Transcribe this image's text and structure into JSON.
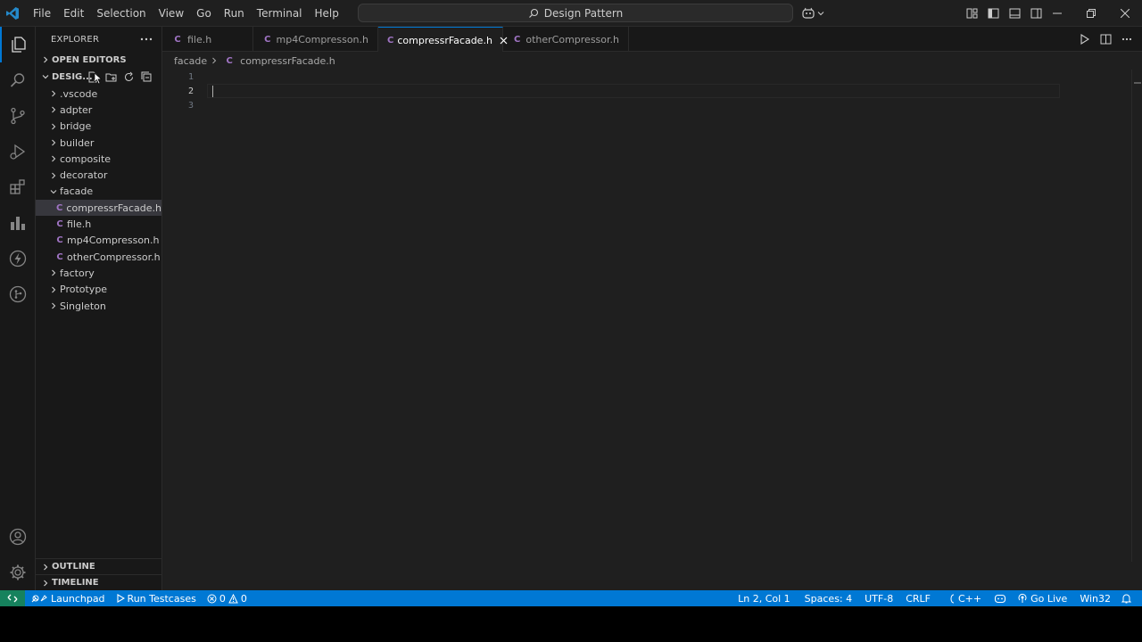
{
  "titlebar": {
    "menus": [
      "File",
      "Edit",
      "Selection",
      "View",
      "Go",
      "Run",
      "Terminal",
      "Help"
    ],
    "search_text": "Design Pattern"
  },
  "explorer": {
    "title": "EXPLORER",
    "open_editors": "OPEN EDITORS",
    "folder_name": "DESIG...",
    "tree": [
      {
        "label": ".vscode",
        "type": "folder",
        "expanded": false
      },
      {
        "label": "adpter",
        "type": "folder",
        "expanded": false
      },
      {
        "label": "bridge",
        "type": "folder",
        "expanded": false
      },
      {
        "label": "builder",
        "type": "folder",
        "expanded": false
      },
      {
        "label": "composite",
        "type": "folder",
        "expanded": false
      },
      {
        "label": "decorator",
        "type": "folder",
        "expanded": false
      },
      {
        "label": "facade",
        "type": "folder",
        "expanded": true
      },
      {
        "label": "compressrFacade.h",
        "type": "file",
        "selected": true
      },
      {
        "label": "file.h",
        "type": "file"
      },
      {
        "label": "mp4Compresson.h",
        "type": "file"
      },
      {
        "label": "otherCompressor.h",
        "type": "file"
      },
      {
        "label": "factory",
        "type": "folder",
        "expanded": false
      },
      {
        "label": "Prototype",
        "type": "folder",
        "expanded": false
      },
      {
        "label": "Singleton",
        "type": "folder",
        "expanded": false
      }
    ],
    "outline": "OUTLINE",
    "timeline": "TIMELINE"
  },
  "tabs": [
    {
      "label": "file.h",
      "icon": "C",
      "active": false
    },
    {
      "label": "mp4Compresson.h",
      "icon": "C",
      "active": false
    },
    {
      "label": "compressrFacade.h",
      "icon": "C",
      "active": true
    },
    {
      "label": "otherCompressor.h",
      "icon": "C",
      "active": false
    }
  ],
  "file_icon_letter": "C",
  "breadcrumb": {
    "folder": "facade",
    "file": "compressrFacade.h"
  },
  "editor": {
    "line_numbers": [
      "1",
      "2",
      "3"
    ],
    "current_line": 2
  },
  "statusbar": {
    "launchpad": "Launchpad",
    "run_testcases": "Run Testcases",
    "errors": "0",
    "warnings": "0",
    "position": "Ln 2, Col 1",
    "spaces": "Spaces: 4",
    "encoding": "UTF-8",
    "eol": "CRLF",
    "language": "C++",
    "go_live": "Go Live",
    "platform": "Win32"
  },
  "colors": {
    "accent": "#0078d4",
    "remote": "#16825d",
    "c_file_icon": "#a074c4",
    "editor_bg": "#1f1f1f",
    "sidebar_bg": "#181818"
  }
}
